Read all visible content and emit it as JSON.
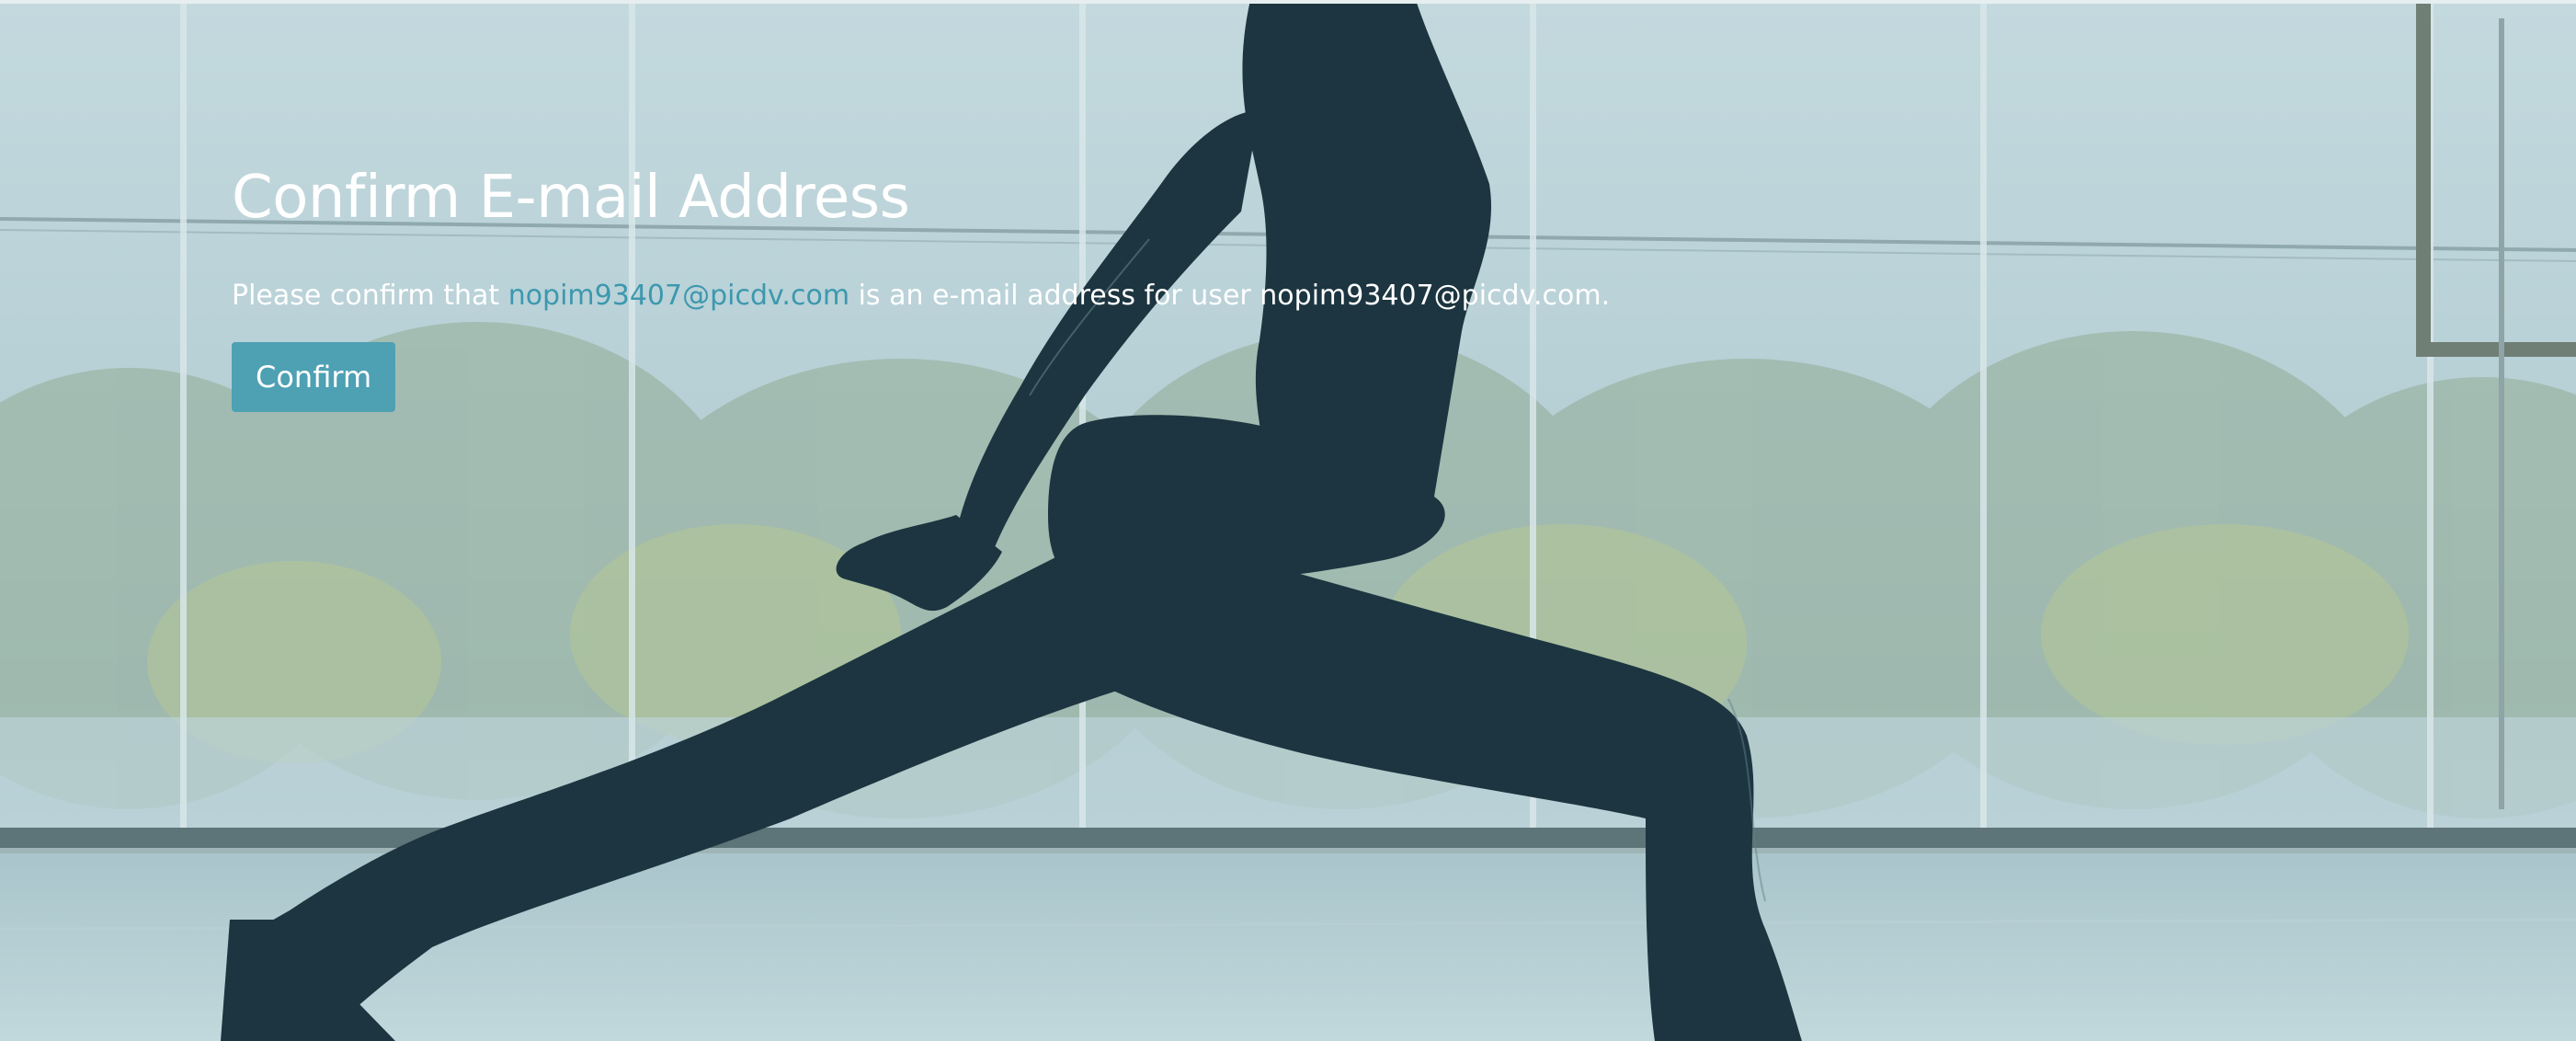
{
  "page": {
    "title": "Confirm E-mail Address",
    "message_prefix": "Please confirm that ",
    "email": "nopim93407@picdv.com",
    "message_middle": " is an e-mail address for user ",
    "username": "nopim93407@picdv.com",
    "message_suffix": ".",
    "confirm_label": "Confirm"
  },
  "colors": {
    "accent": "#4ea0b3",
    "link": "#3d98ae",
    "overlay": "#bcd6dc",
    "silhouette": "#1c3540"
  },
  "background": {
    "subject": "woman-lunge-silhouette"
  }
}
